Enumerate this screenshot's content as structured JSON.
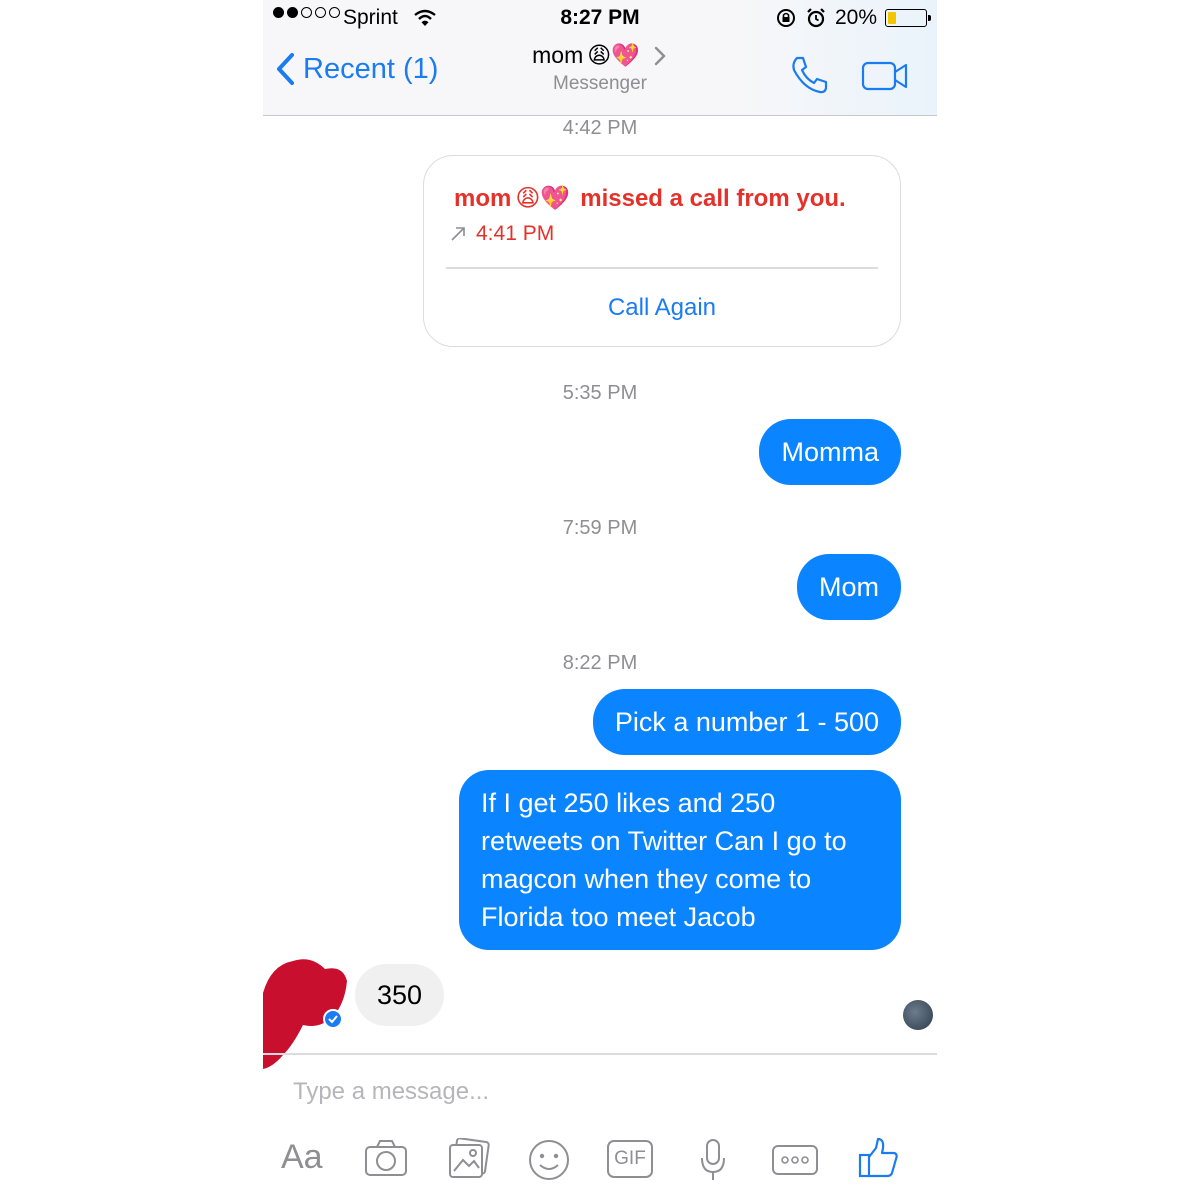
{
  "status_bar": {
    "carrier": "Sprint",
    "time": "8:27 PM",
    "battery": "20%",
    "battery_level": 0.2
  },
  "header": {
    "back_label": "Recent (1)",
    "title": "mom",
    "title_emoji": "😩💖",
    "subtitle": "Messenger"
  },
  "chat": {
    "ts1": "4:42 PM",
    "missed_call": {
      "text": "missed a call from you.",
      "name": "mom",
      "name_emoji": "😩💖",
      "time": "4:41 PM",
      "action": "Call Again"
    },
    "ts2": "5:35 PM",
    "msg1": "Momma",
    "ts3": "7:59 PM",
    "msg2": "Mom",
    "ts4": "8:22 PM",
    "msg3": "Pick a number 1 - 500",
    "msg4": "If I get 250 likes and 250 retweets on Twitter Can I go to magcon when they come to Florida too meet Jacob",
    "reply": "350"
  },
  "composer": {
    "placeholder": "Type a message...",
    "tools": [
      "Aa",
      "camera-icon",
      "photo-icon",
      "emoji-icon",
      "GIF",
      "mic-icon",
      "more-icon",
      "like-icon"
    ]
  },
  "colors": {
    "accent": "#1a7cf0",
    "bubble": "#0a84ff",
    "missed": "#e4322b"
  }
}
